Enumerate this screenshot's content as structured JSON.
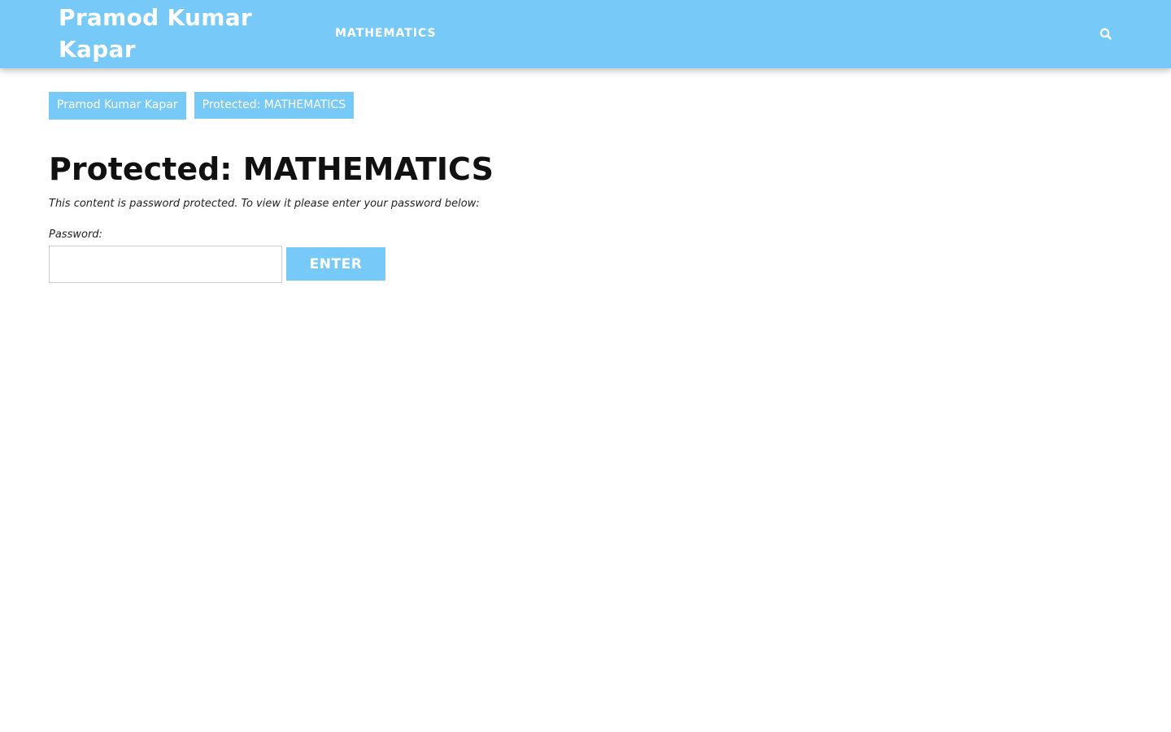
{
  "header": {
    "site_title": "Pramod Kumar Kapar",
    "nav_items": [
      {
        "label": "MATHEMATICS"
      }
    ],
    "search_icon": "search-icon",
    "accent_color": "#77c9f7"
  },
  "breadcrumb": {
    "items": [
      {
        "label": "Pramod Kumar Kapar"
      },
      {
        "label": "Protected: MATHEMATICS"
      }
    ]
  },
  "main": {
    "title": "Protected: MATHEMATICS",
    "notice": "This content is password protected. To view it please enter your password below:",
    "password_label": "Password:",
    "password_value": "",
    "submit_label": "ENTER"
  }
}
